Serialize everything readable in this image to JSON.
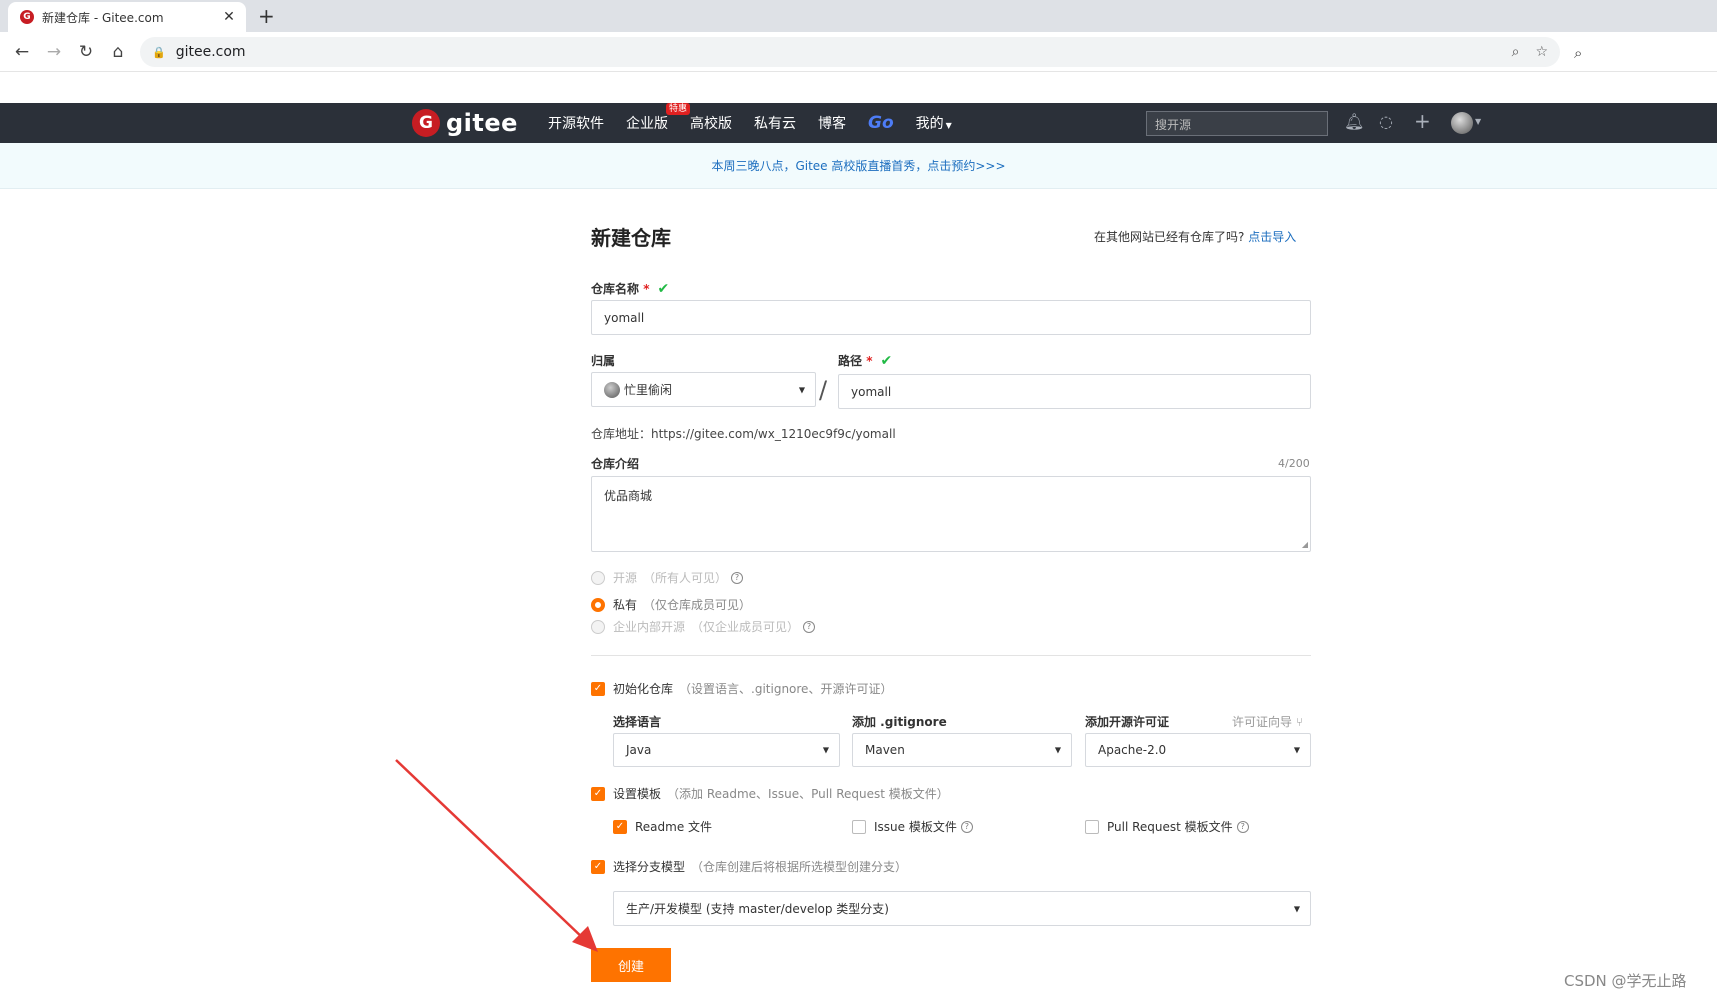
{
  "browser": {
    "tab_title": "新建仓库 - Gitee.com",
    "url": "gitee.com"
  },
  "header": {
    "logo_text": "gitee",
    "nav": [
      "开源软件",
      "企业版",
      "高校版",
      "私有云",
      "博客",
      "Go",
      "我的"
    ],
    "enterprise_tag": "特惠",
    "search_placeholder": "搜开源"
  },
  "banner": "本周三晚八点，Gitee 高校版直播首秀，点击预约>>>",
  "form": {
    "title": "新建仓库",
    "import_hint": "在其他网站已经有仓库了吗?",
    "import_link": "点击导入",
    "repo_name_label": "仓库名称",
    "repo_name_value": "yomall",
    "owner_label": "归属",
    "owner_value": "忙里偷闲",
    "path_label": "路径",
    "path_value": "yomall",
    "repo_address": "仓库地址：https://gitee.com/wx_1210ec9f9c/yomall",
    "intro_label": "仓库介绍",
    "intro_counter": "4/200",
    "intro_value": "优品商城",
    "visibility": [
      {
        "label": "开源",
        "hint": "（所有人可见）",
        "selected": false,
        "disabled": true
      },
      {
        "label": "私有",
        "hint": "（仅仓库成员可见）",
        "selected": true,
        "disabled": false
      },
      {
        "label": "企业内部开源",
        "hint": "（仅企业成员可见）",
        "selected": false,
        "disabled": true
      }
    ],
    "init_repo_label": "初始化仓库",
    "init_repo_hint": "（设置语言、.gitignore、开源许可证）",
    "lang_label": "选择语言",
    "lang_value": "Java",
    "gitignore_label": "添加 .gitignore",
    "gitignore_value": "Maven",
    "license_label": "添加开源许可证",
    "license_guide": "许可证向导 ⑂",
    "license_value": "Apache-2.0",
    "template_label": "设置模板",
    "template_hint": "（添加 Readme、Issue、Pull Request 模板文件）",
    "readme_label": "Readme 文件",
    "issue_label": "Issue 模板文件",
    "pr_label": "Pull Request 模板文件",
    "branch_label": "选择分支模型",
    "branch_hint": "（仓库创建后将根据所选模型创建分支）",
    "branch_value": "生产/开发模型 (支持 master/develop 类型分支)",
    "create_button": "创建"
  },
  "watermark": "CSDN @学无止路",
  "colors": {
    "accent": "#fe7300",
    "header_bg": "#2b3039",
    "link": "#1c6ebf",
    "annotation_arrow": "#e53935"
  }
}
